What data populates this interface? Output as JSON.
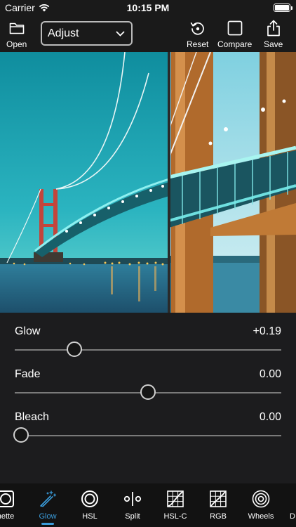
{
  "status_bar": {
    "carrier": "Carrier",
    "time": "10:15 PM"
  },
  "toolbar": {
    "open_label": "Open",
    "mode_value": "Adjust",
    "reset_label": "Reset",
    "compare_label": "Compare",
    "save_label": "Save"
  },
  "adjustments": [
    {
      "name": "Glow",
      "value": "+0.19",
      "level": 0.21
    },
    {
      "name": "Fade",
      "value": "0.00",
      "level": 0.5
    },
    {
      "name": "Bleach",
      "value": "0.00",
      "level": 0.0
    }
  ],
  "tabs": [
    {
      "label": "nette",
      "icon": "vignette-icon"
    },
    {
      "label": "Glow",
      "icon": "glow-wand-icon",
      "active": true
    },
    {
      "label": "HSL",
      "icon": "hsl-ring-icon"
    },
    {
      "label": "Split",
      "icon": "split-icon"
    },
    {
      "label": "HSL-C",
      "icon": "hsl-curve-icon"
    },
    {
      "label": "RGB",
      "icon": "rgb-curve-icon"
    },
    {
      "label": "Wheels",
      "icon": "color-wheels-icon"
    },
    {
      "label": "D",
      "icon": "more-tab-icon"
    }
  ],
  "colors": {
    "accent": "#3a9bd9",
    "background": "#1c1c1e",
    "track": "#7a7a7a"
  }
}
